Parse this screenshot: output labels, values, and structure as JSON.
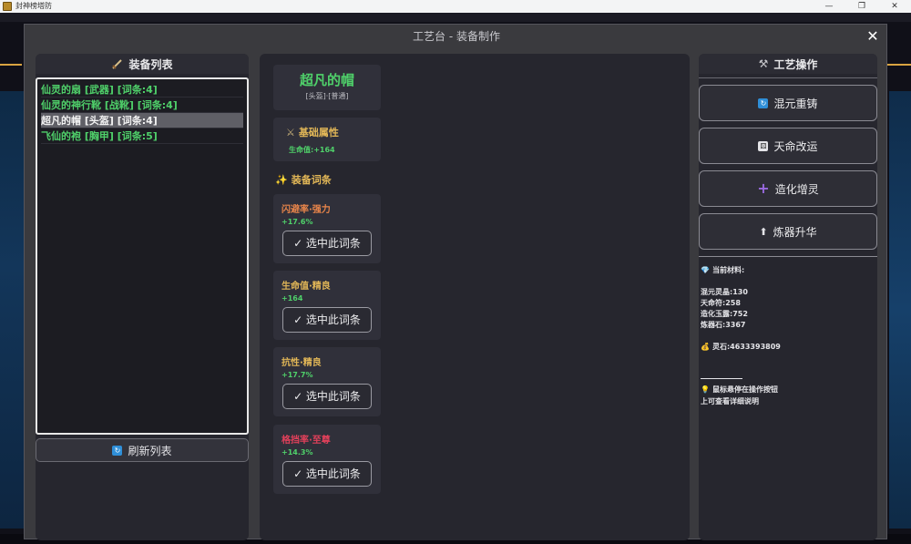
{
  "window": {
    "title": "封神榜塔防",
    "controls": [
      "—",
      "❐",
      "✕"
    ]
  },
  "modal": {
    "title": "工艺台 - 装备制作",
    "close_label": "✕"
  },
  "left": {
    "header": "装备列表",
    "items": [
      {
        "label": "仙灵的扇 [武器] [词条:4]",
        "selected": false
      },
      {
        "label": "仙灵的神行靴 [战靴] [词条:4]",
        "selected": false
      },
      {
        "label": "超凡的帽 [头盔] [词条:4]",
        "selected": true
      },
      {
        "label": "飞仙的袍 [胸甲] [词条:5]",
        "selected": false
      }
    ],
    "refresh_label": "刷新列表"
  },
  "center": {
    "item_name": "超凡的帽",
    "item_sub": "[头盔]·[普通]",
    "base_title": "基础属性",
    "base_value": "生命值:+164",
    "affix_heading": "装备词条",
    "select_label": "✓ 选中此词条",
    "affixes": [
      {
        "name": "闪避率·强力",
        "value": "+17.6%",
        "color": "#e8854a"
      },
      {
        "name": "生命值·精良",
        "value": "+164",
        "color": "#e2b757"
      },
      {
        "name": "抗性·精良",
        "value": "+17.7%",
        "color": "#e2b757"
      },
      {
        "name": "格挡率·至尊",
        "value": "+14.3%",
        "color": "#e0405a"
      }
    ]
  },
  "right": {
    "header": "工艺操作",
    "ops": [
      "混元重铸",
      "天命改运",
      "造化增灵",
      "炼器升华"
    ],
    "materials_title": "当前材料:",
    "materials": [
      "混元灵晶:130",
      "天命符:258",
      "造化玉露:752",
      "炼器石:3367"
    ],
    "spirit_stone": "灵石:4633393809",
    "hint_line1": "鼠标悬停在操作按钮",
    "hint_line2": "上可查看详细说明"
  },
  "icons": [
    "app-icon",
    "sword-icon",
    "sparkle-icon",
    "hammer-pick-icon",
    "refresh-icon",
    "dice-icon",
    "plus-icon",
    "arrow-up-icon",
    "gem-icon",
    "money-bag-icon",
    "lightbulb-icon",
    "crossed-swords-icon"
  ]
}
